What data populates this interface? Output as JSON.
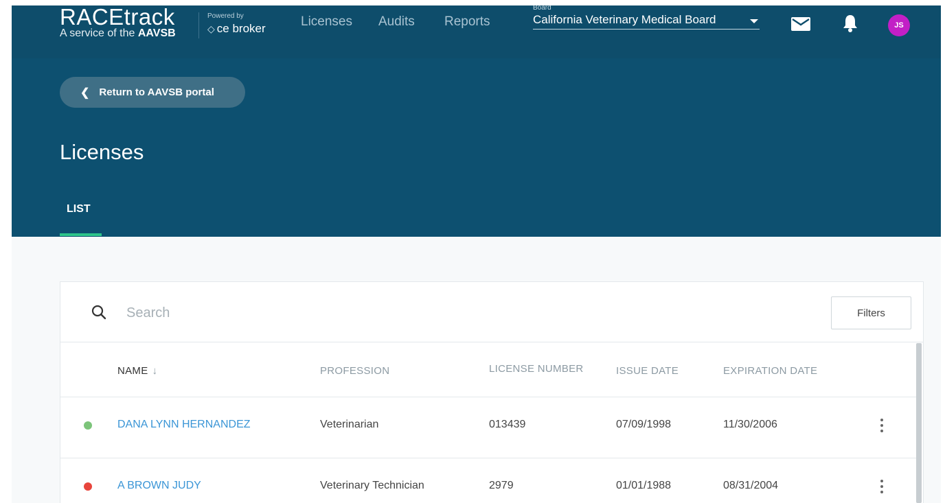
{
  "brand": {
    "title": "RACEtrack",
    "subtitle_prefix": "A service of the",
    "subtitle_bold": "AAVSB",
    "powered_by": "Powered by",
    "partner": "ce broker"
  },
  "nav": {
    "items": [
      "Licenses",
      "Audits",
      "Reports"
    ]
  },
  "board": {
    "label": "Board",
    "selected": "California Veterinary Medical Board"
  },
  "user": {
    "initials": "JS"
  },
  "hero": {
    "return_label": "Return to AAVSB portal",
    "page_title": "Licenses",
    "tab": "LIST"
  },
  "search": {
    "placeholder": "Search"
  },
  "filters_label": "Filters",
  "table": {
    "columns": [
      "NAME",
      "PROFESSION",
      "LICENSE NUMBER",
      "ISSUE DATE",
      "EXPIRATION DATE"
    ],
    "rows": [
      {
        "status_color": "#7cc47a",
        "name": "DANA LYNN HERNANDEZ",
        "profession": "Veterinarian",
        "license_number": "013439",
        "issue_date": "07/09/1998",
        "expiration_date": "11/30/2006"
      },
      {
        "status_color": "#e8453c",
        "name": "A BROWN JUDY",
        "profession": "Veterinary Technician",
        "license_number": "2979",
        "issue_date": "01/01/1988",
        "expiration_date": "08/31/2004"
      }
    ]
  },
  "colors": {
    "topbar": "#0e4d6b",
    "hero": "#0d5070",
    "accent_tab": "#2ec58a",
    "link": "#3a95d6",
    "avatar": "#c21fc6"
  }
}
